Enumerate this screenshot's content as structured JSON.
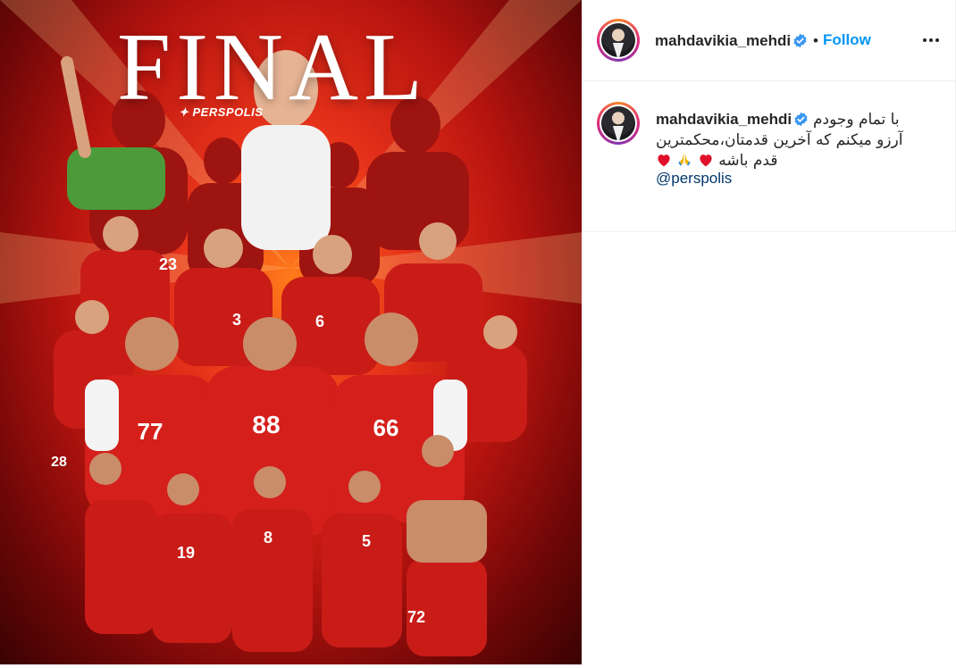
{
  "post": {
    "image": {
      "title": "FINAL",
      "brand": "PERSPOLIS",
      "jersey_numbers": [
        "23",
        "3",
        "6",
        "77",
        "88",
        "66",
        "19",
        "8",
        "5",
        "72",
        "28"
      ],
      "accent_color": "#d41f1b"
    },
    "header": {
      "username": "mahdavikia_mehdi",
      "verified": true,
      "separator": "•",
      "follow_label": "Follow",
      "more_icon": "more-horizontal-icon"
    },
    "caption": {
      "username": "mahdavikia_mehdi",
      "line1": "با تمام وجودم",
      "line2": "آرزو میکنم که آخرین قدمتان،محکمترین",
      "line3": "قدم باشه",
      "emojis": [
        "red-heart",
        "folded-hands",
        "red-heart"
      ],
      "mention": "@perspolis"
    }
  },
  "colors": {
    "link_blue": "#0095f6",
    "mention_blue": "#00376b",
    "verified_blue": "#3897f0",
    "text": "#262626",
    "border": "#efefef"
  }
}
